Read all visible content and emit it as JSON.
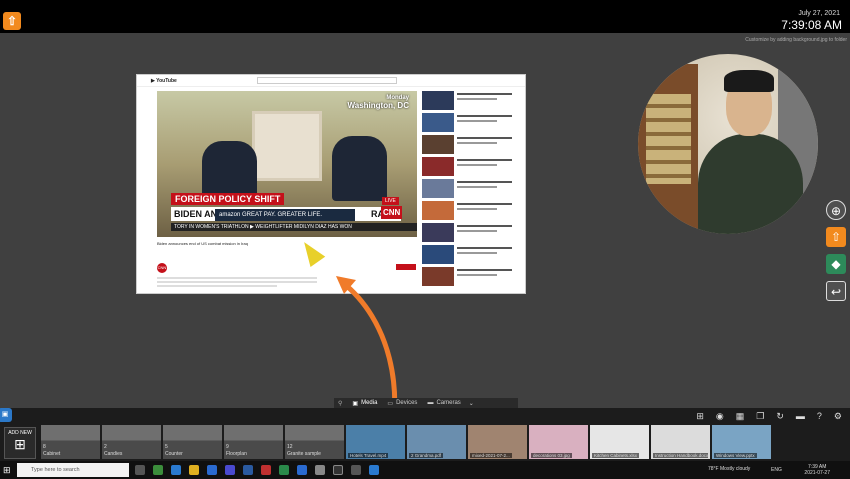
{
  "header": {
    "date": "July 27, 2021",
    "time": "7:39:08 AM",
    "hint": "Customize by adding background.jpg to folder"
  },
  "video": {
    "location_line1": "Monday",
    "location_line2": "Washington, DC",
    "banner_top": "FOREIGN POLICY SHIFT",
    "banner_main": "BIDEN ANNC",
    "banner_main_end": "RAQ",
    "ad_text": "amazon  GREAT PAY. GREATER LIFE.",
    "live": "LIVE",
    "network": "CNN",
    "ticker": "TORY IN WOMEN'S TRIATHLON  ▶ WEIGHTLIFTER MIDILYN DIAZ HAS WON",
    "title": "Biden announces end of US combat mission in Iraq",
    "channel_badge": "CNN"
  },
  "stage_tabs": [
    {
      "label": "Media",
      "active": true,
      "icon": "media-icon"
    },
    {
      "label": "Devices",
      "active": false,
      "icon": "devices-icon"
    },
    {
      "label": "Cameras",
      "active": false,
      "icon": "camera-icon"
    }
  ],
  "tray": {
    "add_new": "ADD NEW",
    "folders": [
      {
        "count": "8",
        "name": "Cabinet"
      },
      {
        "count": "2",
        "name": "Candies"
      },
      {
        "count": "5",
        "name": "Counter"
      },
      {
        "count": "9",
        "name": "Floorplan"
      },
      {
        "count": "12",
        "name": "Granite sample"
      }
    ],
    "files": [
      {
        "name": "Hotels Travel.mp4",
        "color": "#4b7fa8"
      },
      {
        "name": "2 Grandma.pdf",
        "color": "#6a8eae"
      },
      {
        "name": "mixed-2021-07-2...",
        "color": "#a08470"
      },
      {
        "name": "decorations 03.jpg",
        "color": "#d9b0c0"
      },
      {
        "name": "Kitchen Cabinets.xlsx",
        "color": "#e6e6e6"
      },
      {
        "name": "Instruction Handbook.docx",
        "color": "#dcdcdc"
      },
      {
        "name": "Windows View.pptx",
        "color": "#7aa4c4"
      }
    ]
  },
  "taskbar": {
    "search_placeholder": "Type here to search",
    "weather": "78°F  Mostly cloudy",
    "lang": "ENG",
    "clock_time": "7:39 AM",
    "clock_date": "2021-07-27"
  }
}
